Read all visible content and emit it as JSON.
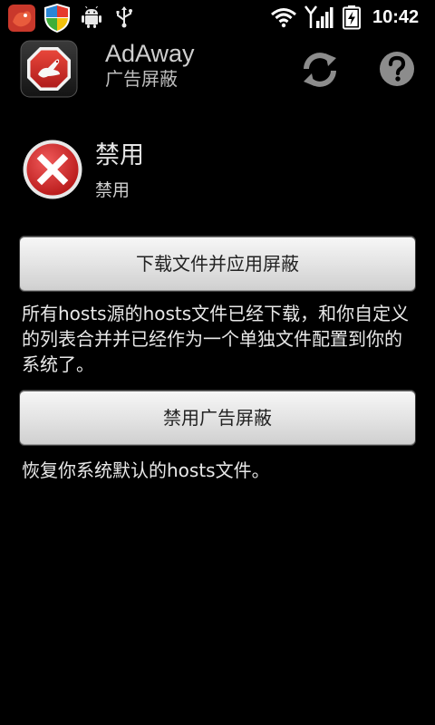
{
  "status_bar": {
    "time": "10:42",
    "icons": [
      "notification-app-icon",
      "shield-app-icon",
      "android-icon",
      "usb-icon",
      "wifi-icon",
      "signal-icon",
      "battery-charging-icon"
    ]
  },
  "action_bar": {
    "title": "AdAway",
    "subtitle": "广告屏蔽",
    "actions": [
      "refresh-icon",
      "help-icon"
    ]
  },
  "status": {
    "title": "禁用",
    "subtitle": "禁用",
    "icon": "disabled-x-icon"
  },
  "download_button": {
    "label": "下载文件并应用屏蔽",
    "description": "所有hosts源的hosts文件已经下载，和你自定义的列表合并并已经作为一个单独文件配置到你的系统了。"
  },
  "disable_button": {
    "label": "禁用广告屏蔽",
    "description": "恢复你系统默认的hosts文件。"
  },
  "colors": {
    "background": "#000000",
    "button_gradient_top": "#f7f7f7",
    "button_gradient_bottom": "#cfcfcf",
    "status_red": "#d4252c"
  }
}
